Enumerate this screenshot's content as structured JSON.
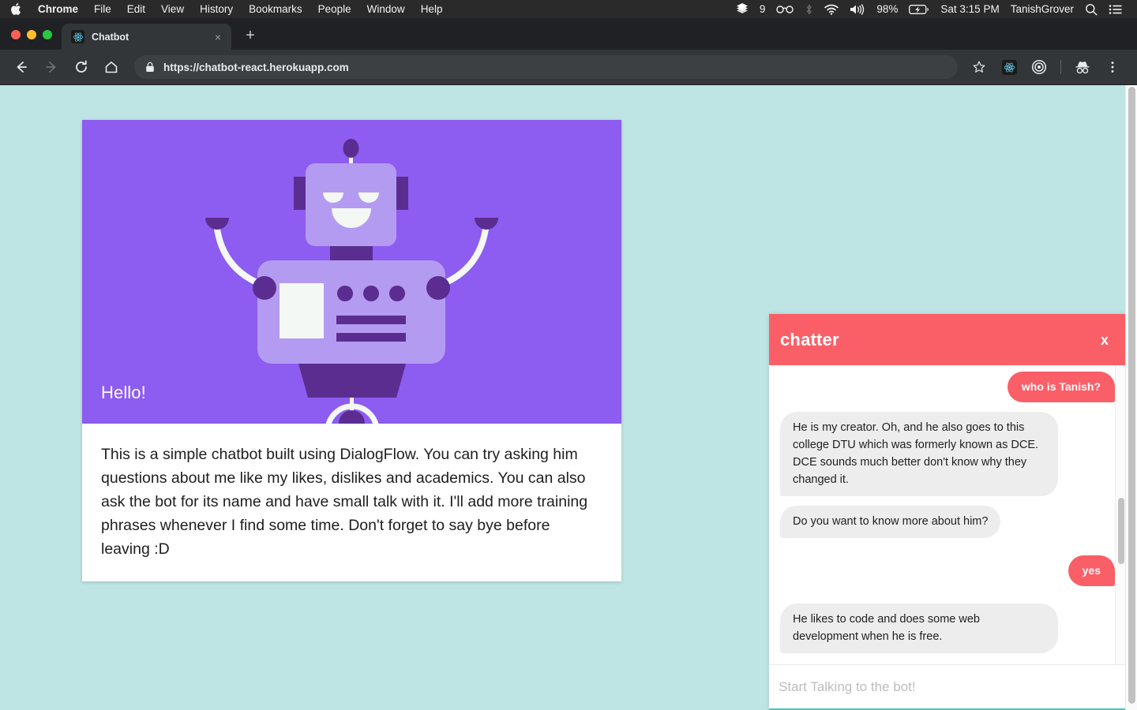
{
  "menubar": {
    "apple": "apple-logo",
    "items": [
      {
        "label": "Chrome",
        "bold": true
      },
      {
        "label": "File",
        "bold": false
      },
      {
        "label": "Edit",
        "bold": false
      },
      {
        "label": "View",
        "bold": false
      },
      {
        "label": "History",
        "bold": false
      },
      {
        "label": "Bookmarks",
        "bold": false
      },
      {
        "label": "People",
        "bold": false
      },
      {
        "label": "Window",
        "bold": false
      },
      {
        "label": "Help",
        "bold": false
      }
    ],
    "status": {
      "stack_badge": "9",
      "battery": "98%",
      "datetime": "Sat 3:15 PM",
      "user": "TanishGrover"
    }
  },
  "browser": {
    "tab": {
      "title": "Chatbot",
      "favicon": "react-logo-icon",
      "close": "×"
    },
    "newtab_label": "+",
    "url": "https://chatbot-react.herokuapp.com"
  },
  "page": {
    "card": {
      "greeting": "Hello!",
      "hero_bg": "#8d5cf0",
      "description": "This is a simple chatbot built using DialogFlow. You can try asking him questions about me like my likes, dislikes and academics. You can also ask the bot for its name and have small talk with it. I'll add more training phrases whenever I find some time. Don't forget to say bye before leaving :D"
    },
    "background_color": "#bee4e3"
  },
  "chat": {
    "title": "chatter",
    "close_label": "x",
    "accent_color": "#fa5f68",
    "bot_bubble_color": "#ededed",
    "input_underline_color": "#4dc4b8",
    "messages": [
      {
        "from": "user",
        "text": "who is Tanish?"
      },
      {
        "from": "bot",
        "text": "He is my creator. Oh, and he also goes to this college DTU which was formerly known as DCE. DCE sounds much better don't know why they changed it."
      },
      {
        "from": "bot",
        "text": "Do you want to know more about him?"
      },
      {
        "from": "user",
        "text": "yes"
      },
      {
        "from": "bot",
        "text": "He likes to code and does some web development when he is free."
      }
    ],
    "input": {
      "value": "",
      "placeholder": "Start Talking to the bot!"
    }
  }
}
